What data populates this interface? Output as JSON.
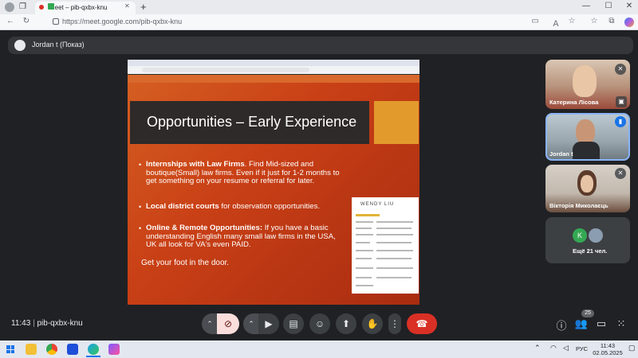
{
  "browser": {
    "tab_title": "Meet – pib-qxbx-knu",
    "tab_close": "✕",
    "new_tab": "+",
    "url": "https://meet.google.com/pib-qxbx-knu",
    "win_min": "—",
    "win_max": "☐",
    "win_close": "✕"
  },
  "meet": {
    "presenter_label": "Jordan t (Показ)",
    "meeting_code": "pib-qxbx-knu",
    "time": "11:43",
    "separator": "|",
    "participant_count_badge": "25",
    "others_label": "Ещё 21 чел."
  },
  "slide": {
    "title": "Opportunities – Early Experience",
    "bullets": [
      {
        "bold": "Internships with Law Firms",
        "text": ". Find Mid-sized and boutique(Small) law firms. Even if it just for 1-2 months to get something on your resume or referral for later."
      },
      {
        "bold": "Local district courts",
        "text": " for observation opportunities."
      },
      {
        "bold": "Online & Remote Opportunities:",
        "text": " If you have a basic understanding English many small law firms in the USA, UK all look for VA's even PAID."
      }
    ],
    "footer": "Get your foot in the door.",
    "resume_name": "WENDY LIU"
  },
  "participants": [
    {
      "name": "Катерина Лісова"
    },
    {
      "name": "Jordan t"
    },
    {
      "name": "Вікторія Миколаєць"
    }
  ],
  "others_avatar_letter": "K",
  "taskbar": {
    "lang": "РУС",
    "time": "11:43",
    "date": "02.05.2025"
  },
  "colors": {
    "meet_bg": "#202124",
    "end_call": "#d93025",
    "mic_off": "#f9dedc",
    "slide_orange": "#c94016",
    "slide_gold": "#e39a2d"
  }
}
